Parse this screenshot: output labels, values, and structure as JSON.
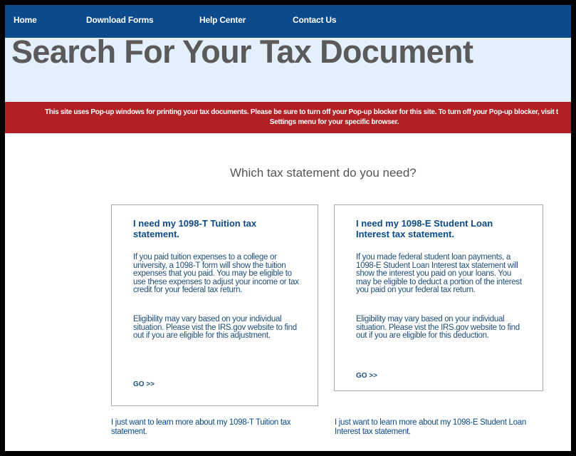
{
  "nav": {
    "items": [
      "Home",
      "Download Forms",
      "Help Center",
      "Contact Us"
    ]
  },
  "hero": {
    "title": "Search For Your Tax Document"
  },
  "alert": {
    "line1": "This site uses Pop-up windows for printing your tax documents. Please be sure to turn off your Pop-up blocker for this site. To turn off your Pop-up blocker, visit t",
    "line2": "Settings menu for your specific browser."
  },
  "main": {
    "question": "Which tax statement do you need?",
    "cards": [
      {
        "title": "I need my 1098-T Tuition tax statement.",
        "para1": "If you paid tuition expenses to a college or university, a 1098-T form will show the tuition expenses that you paid. You may be eligible to use these expenses to adjust your income or tax credit for your federal tax return.",
        "para2": "Eligibility may vary based on your individual situation. Please vist the IRS.gov website to find out if you are eligible for this adjustment.",
        "go": "GO >>",
        "learn_more": "I just want to learn more about my 1098-T Tuition tax statement."
      },
      {
        "title": "I need my 1098-E Student Loan Interest tax statement.",
        "para1": "If you made federal student loan payments, a 1098-E Student Loan Interest tax statement will show the interest you paid on your loans. You may be eligible to deduct a portion of the interest you paid on your federal tax return.",
        "para2": "Eligibility may vary based on your individual situation. Please vist the IRS.gov website to find out if you are eligible for this deduction.",
        "go": "GO >>",
        "learn_more": "I just want to learn more about my 1098-E Student Loan Interest tax statement."
      }
    ]
  },
  "colors": {
    "nav_bg": "#0b4b8c",
    "hero_bg": "#e3f0fb",
    "alert_bg": "#b22024",
    "link": "#0b4b8c"
  }
}
